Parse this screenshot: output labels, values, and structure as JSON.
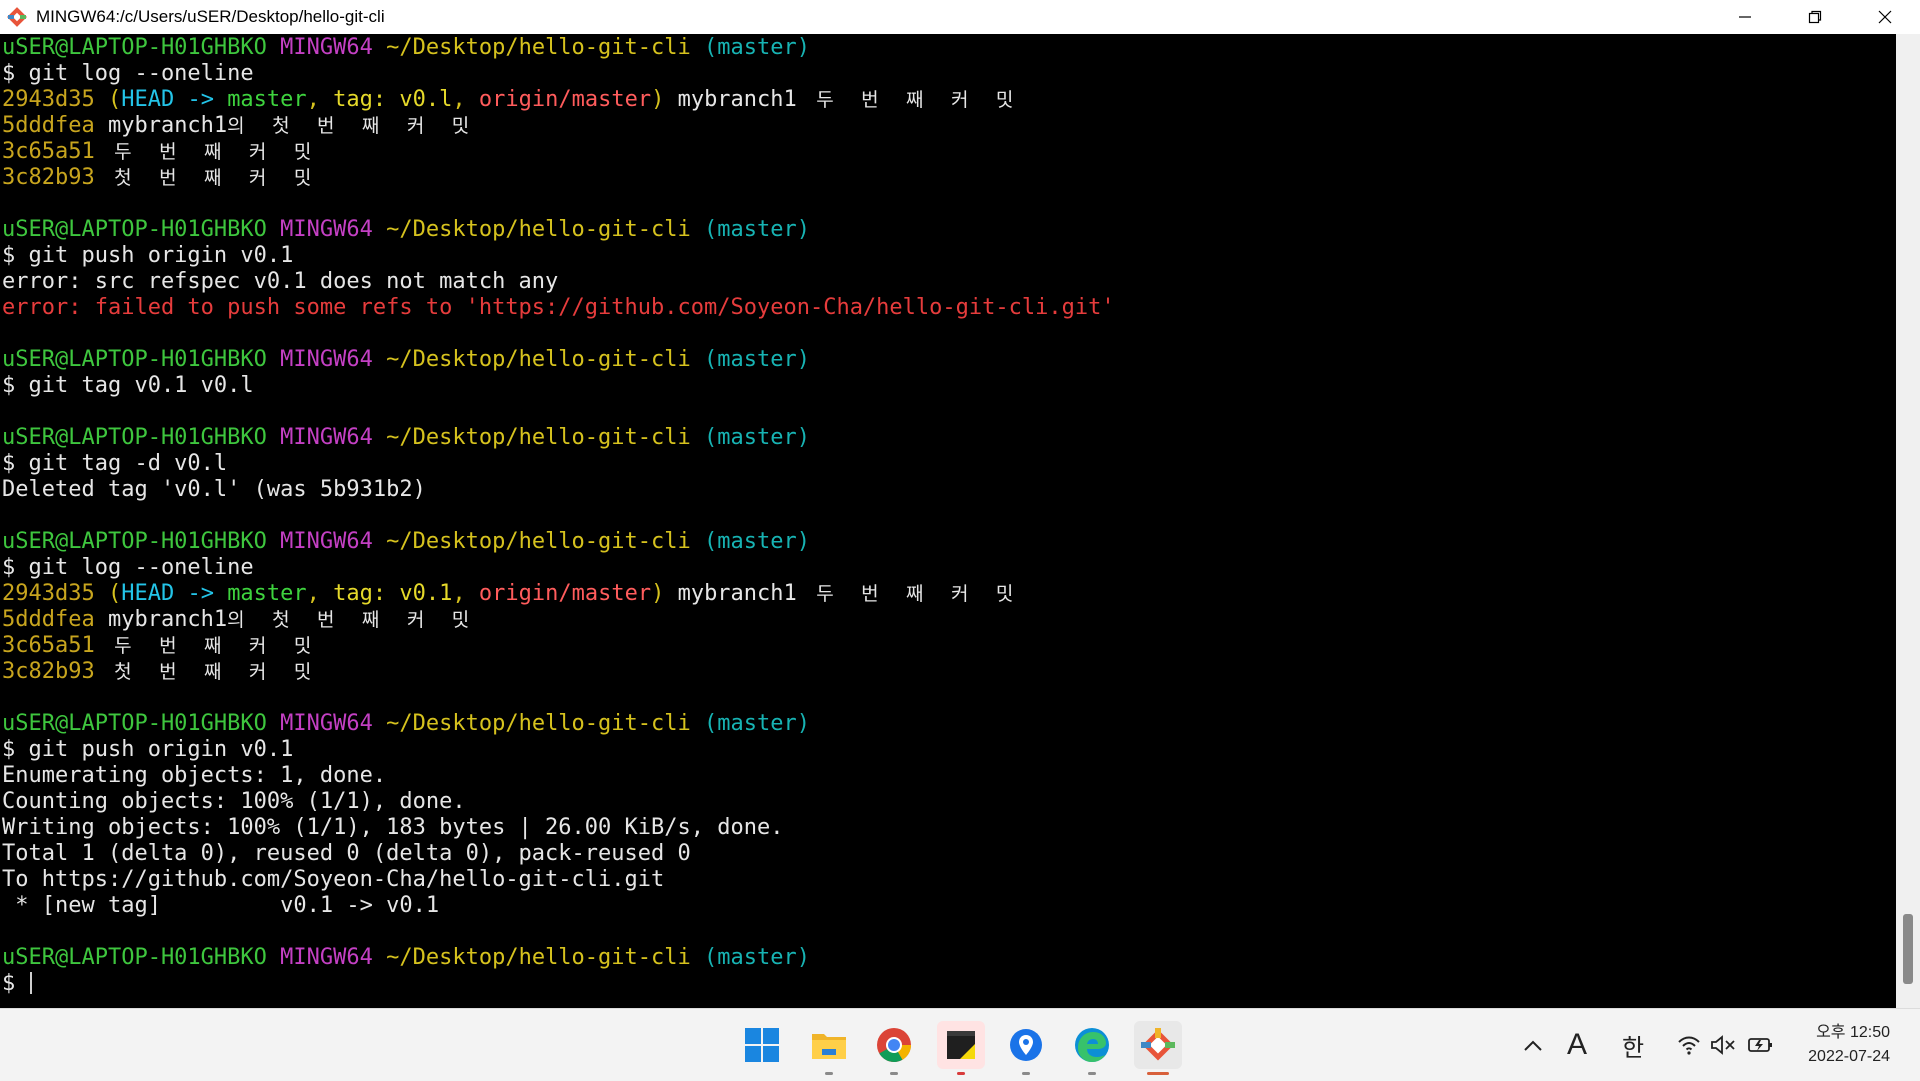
{
  "window": {
    "title": "MINGW64:/c/Users/uSER/Desktop/hello-git-cli"
  },
  "prompt": {
    "user": "uSER@LAPTOP-H01GHBKO",
    "shell": "MINGW64",
    "path": "~/Desktop/hello-git-cli",
    "branch": "(master)"
  },
  "log1": {
    "cmd": "$ git log --oneline",
    "hash1": "2943d35",
    "open": " (",
    "head": "HEAD",
    "arrow": " -> ",
    "master": "master",
    "comma": ", ",
    "tag": "tag: v0.l",
    "origin": "origin/master",
    "close": ")",
    "mybranch": " mybranch1",
    "msg1": " 두 번 째 커 밋",
    "hash2": "5dddfea",
    "mybranch2": " mybranch1",
    "msg2": "의 첫 번 째 커 밋",
    "hash3": "3c65a51",
    "msg3": " 두 번 째 커 밋",
    "hash4": "3c82b93",
    "msg4": " 첫 번 째 커 밋"
  },
  "push1": {
    "cmd": "$ git push origin v0.1",
    "err1": "error: src refspec v0.1 does not match any",
    "err2": "error: failed to push some refs to 'https://github.com/Soyeon-Cha/hello-git-cli.git'"
  },
  "tag1": {
    "cmd": "$ git tag v0.1 v0.l"
  },
  "tag2": {
    "cmd": "$ git tag -d v0.l",
    "out": "Deleted tag 'v0.l' (was 5b931b2)"
  },
  "log2": {
    "cmd": "$ git log --oneline",
    "hash1": "2943d35",
    "open": " (",
    "head": "HEAD",
    "arrow": " -> ",
    "master": "master",
    "comma": ", ",
    "tag": "tag: v0.1",
    "origin": "origin/master",
    "close": ")",
    "mybranch": " mybranch1",
    "msg1": " 두 번 째 커 밋",
    "hash2": "5dddfea",
    "mybranch2": " mybranch1",
    "msg2": "의 첫 번 째 커 밋",
    "hash3": "3c65a51",
    "msg3": " 두 번 째 커 밋",
    "hash4": "3c82b93",
    "msg4": " 첫 번 째 커 밋"
  },
  "push2": {
    "cmd": "$ git push origin v0.1",
    "out1": "Enumerating objects: 1, done.",
    "out2": "Counting objects: 100% (1/1), done.",
    "out3": "Writing objects: 100% (1/1), 183 bytes | 26.00 KiB/s, done.",
    "out4": "Total 1 (delta 0), reused 0 (delta 0), pack-reused 0",
    "out5": "To https://github.com/Soyeon-Cha/hello-git-cli.git",
    "out6": " * [new tag]         v0.1 -> v0.1"
  },
  "final": {
    "cmd": "$ "
  },
  "taskbar": {
    "apps": [
      "start-icon",
      "file-explorer-icon",
      "chrome-icon",
      "sticky-notes-icon",
      "maps-icon",
      "edge-icon",
      "git-bash-icon"
    ],
    "tray_font": "A",
    "tray_ime": "한",
    "clock_time": "오후 12:50",
    "clock_date": "2022-07-24"
  },
  "colors": {
    "prompt_user": "#3ec63e",
    "prompt_shell": "#c440c4",
    "prompt_path": "#d6c21e",
    "prompt_branch": "#17b3b3",
    "error": "#e63c3c"
  }
}
